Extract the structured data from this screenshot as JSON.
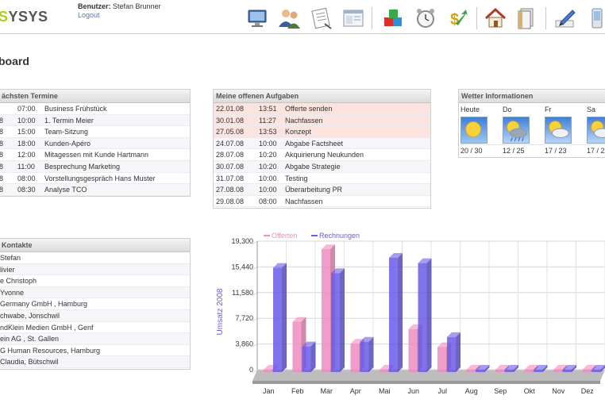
{
  "header": {
    "logo_text": "SYSYS",
    "user_label": "Benutzer:",
    "user_name": "Stefan Brunner",
    "logout": "Logout"
  },
  "toolbar_icons": [
    "monitor-icon",
    "users-icon",
    "notes-icon",
    "window-icon",
    "blocks-icon",
    "alarm-clock-icon",
    "money-arrow-icon",
    "home-icon",
    "documents-icon",
    "pen-icon",
    "phone-icon"
  ],
  "page_title": "board",
  "termine": {
    "title": "ächsten Termine",
    "rows": [
      {
        "date": "",
        "time": "07:00",
        "text": "Business Frühstück"
      },
      {
        "date": "8",
        "time": "10:00",
        "text": "1. Termin Meier"
      },
      {
        "date": "8",
        "time": "15:00",
        "text": "Team-Sitzung"
      },
      {
        "date": "8",
        "time": "18:00",
        "text": "Kunden-Apéro"
      },
      {
        "date": "8",
        "time": "12:00",
        "text": "Mitagessen mit Kunde Hartmann"
      },
      {
        "date": "8",
        "time": "11:00",
        "text": "Besprechung Marketing"
      },
      {
        "date": "8",
        "time": "08:00",
        "text": "Vorstellungsgespräch Hans Muster"
      },
      {
        "date": "8",
        "time": "08:30",
        "text": "Analyse TCO"
      }
    ]
  },
  "aufgaben": {
    "title": "Meine offenen Aufgaben",
    "rows": [
      {
        "date": "22.01.08",
        "time": "13:51",
        "text": "Offerte senden",
        "overdue": true
      },
      {
        "date": "30.01.08",
        "time": "11:27",
        "text": "Nachfassen",
        "overdue": true
      },
      {
        "date": "27.05.08",
        "time": "13:53",
        "text": "Konzept",
        "overdue": true
      },
      {
        "date": "24.07.08",
        "time": "10:00",
        "text": "Abgabe Factsheet",
        "overdue": false
      },
      {
        "date": "28.07.08",
        "time": "10:20",
        "text": "Akquirierung Neukunden",
        "overdue": false
      },
      {
        "date": "30.07.08",
        "time": "10:20",
        "text": "Abgabe Strategie",
        "overdue": false
      },
      {
        "date": "31.07.08",
        "time": "10:00",
        "text": "Testing",
        "overdue": false
      },
      {
        "date": "27.08.08",
        "time": "10:00",
        "text": "Überarbeitung PR",
        "overdue": false
      },
      {
        "date": "29.08.08",
        "time": "08:00",
        "text": "Nachfassen",
        "overdue": false
      }
    ]
  },
  "wetter": {
    "title": "Wetter Informationen",
    "days": [
      {
        "day": "Heute",
        "temp": "20 / 30",
        "icon": "sun-icon"
      },
      {
        "day": "Do",
        "temp": "12 / 25",
        "icon": "sun-cloud-rain-icon"
      },
      {
        "day": "Fr",
        "temp": "17 / 23",
        "icon": "sun-cloud-icon"
      },
      {
        "day": "Sa",
        "temp": "17 / 2",
        "icon": "sun-cloud-icon"
      }
    ]
  },
  "kontakte": {
    "title": "Kontakte",
    "rows": [
      "Stefan",
      "livier",
      "e Christoph",
      "Yvonne",
      "Germany GmbH , Hamburg",
      "chwabe, Jonschwil",
      "ndKlein Medien GmbH , Genf",
      "ein AG , St. Gallen",
      "G Human Resources, Hamburg",
      "Claudia, Bütschwil"
    ]
  },
  "colors": {
    "offerten": "#f08cc0",
    "rechnungen": "#6a5ae8",
    "overdue_row": "#fbe3df",
    "logo_accent": "#b5cc18"
  },
  "chart_data": {
    "type": "bar",
    "categories": [
      "Jan",
      "Feb",
      "Mar",
      "Apr",
      "Mai",
      "Jun",
      "Jul",
      "Aug",
      "Sep",
      "Okt",
      "Nov",
      "Dez"
    ],
    "series": [
      {
        "name": "Offerten",
        "values": [
          0,
          7200,
          18100,
          3900,
          0,
          6100,
          3400,
          0,
          0,
          0,
          0,
          0
        ]
      },
      {
        "name": "Rechnungen",
        "values": [
          15300,
          3500,
          14500,
          4200,
          16800,
          16000,
          4900,
          0,
          0,
          0,
          0,
          0
        ]
      }
    ],
    "ylabel": "Umsatz 2008",
    "yticks": [
      "0",
      "3,860",
      "7,720",
      "11,580",
      "15,440",
      "19,300"
    ],
    "ylim": [
      0,
      19300
    ],
    "grid": true,
    "legend": "top"
  }
}
